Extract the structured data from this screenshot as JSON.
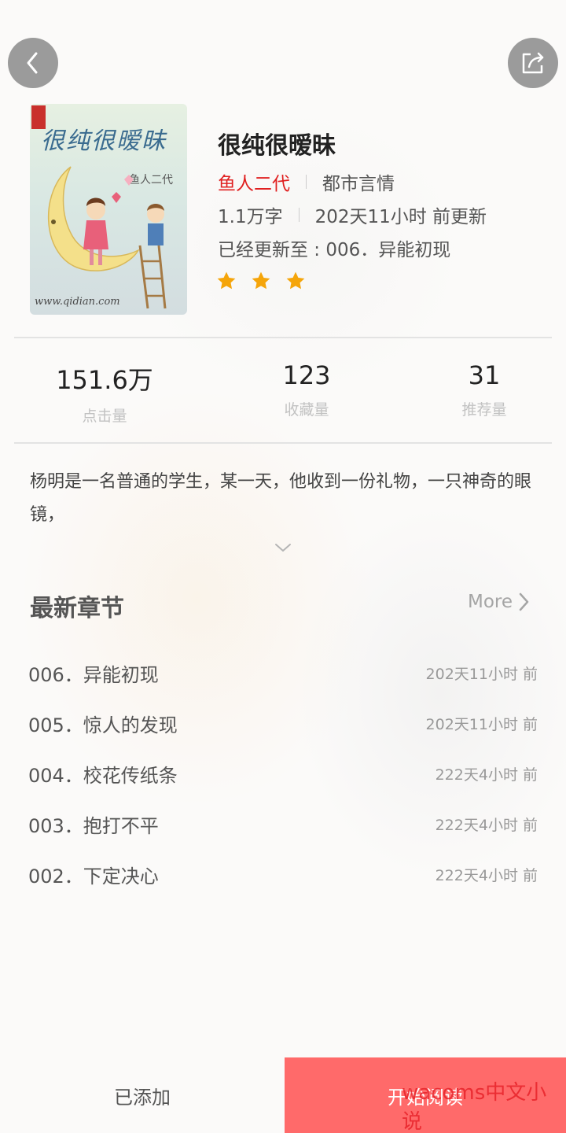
{
  "book": {
    "title": "很纯很暧昧",
    "author": "鱼人二代",
    "genre": "都市言情",
    "word_count": "1.1万字",
    "update_time": "202天11小时 前更新",
    "latest": "已经更新至 : 006．异能初现",
    "rating_stars": 3,
    "cover": {
      "title": "很纯很暧昧",
      "author": "鱼人二代",
      "site": "www.qidian.com"
    }
  },
  "stats": [
    {
      "value": "151.6万",
      "label": "点击量"
    },
    {
      "value": "123",
      "label": "收藏量"
    },
    {
      "value": "31",
      "label": "推荐量"
    }
  ],
  "intro": "杨明是一名普通的学生，某一天，他收到一份礼物，一只神奇的眼镜，",
  "chapters_section": {
    "title": "最新章节",
    "more_label": "More"
  },
  "chapters": [
    {
      "name": "006．异能初现",
      "time": "202天11小时 前"
    },
    {
      "name": "005．惊人的发现",
      "time": "202天11小时 前"
    },
    {
      "name": "004．校花传纸条",
      "time": "222天4小时 前"
    },
    {
      "name": "003．抱打不平",
      "time": "222天4小时 前"
    },
    {
      "name": "002．下定决心",
      "time": "222天4小时 前"
    }
  ],
  "bottom": {
    "added_label": "已添加",
    "read_label": "开始阅读",
    "watermark": "wacoms中文小说"
  },
  "colors": {
    "accent_red": "#e02020",
    "read_button": "#ff6a6a",
    "star": "#f5a50a",
    "icon_circle": "#9b9b9b"
  },
  "icons": {
    "back": "chevron-left-icon",
    "share": "share-icon",
    "expand": "chevron-down-icon",
    "more": "chevron-right-icon",
    "star": "star-icon"
  }
}
